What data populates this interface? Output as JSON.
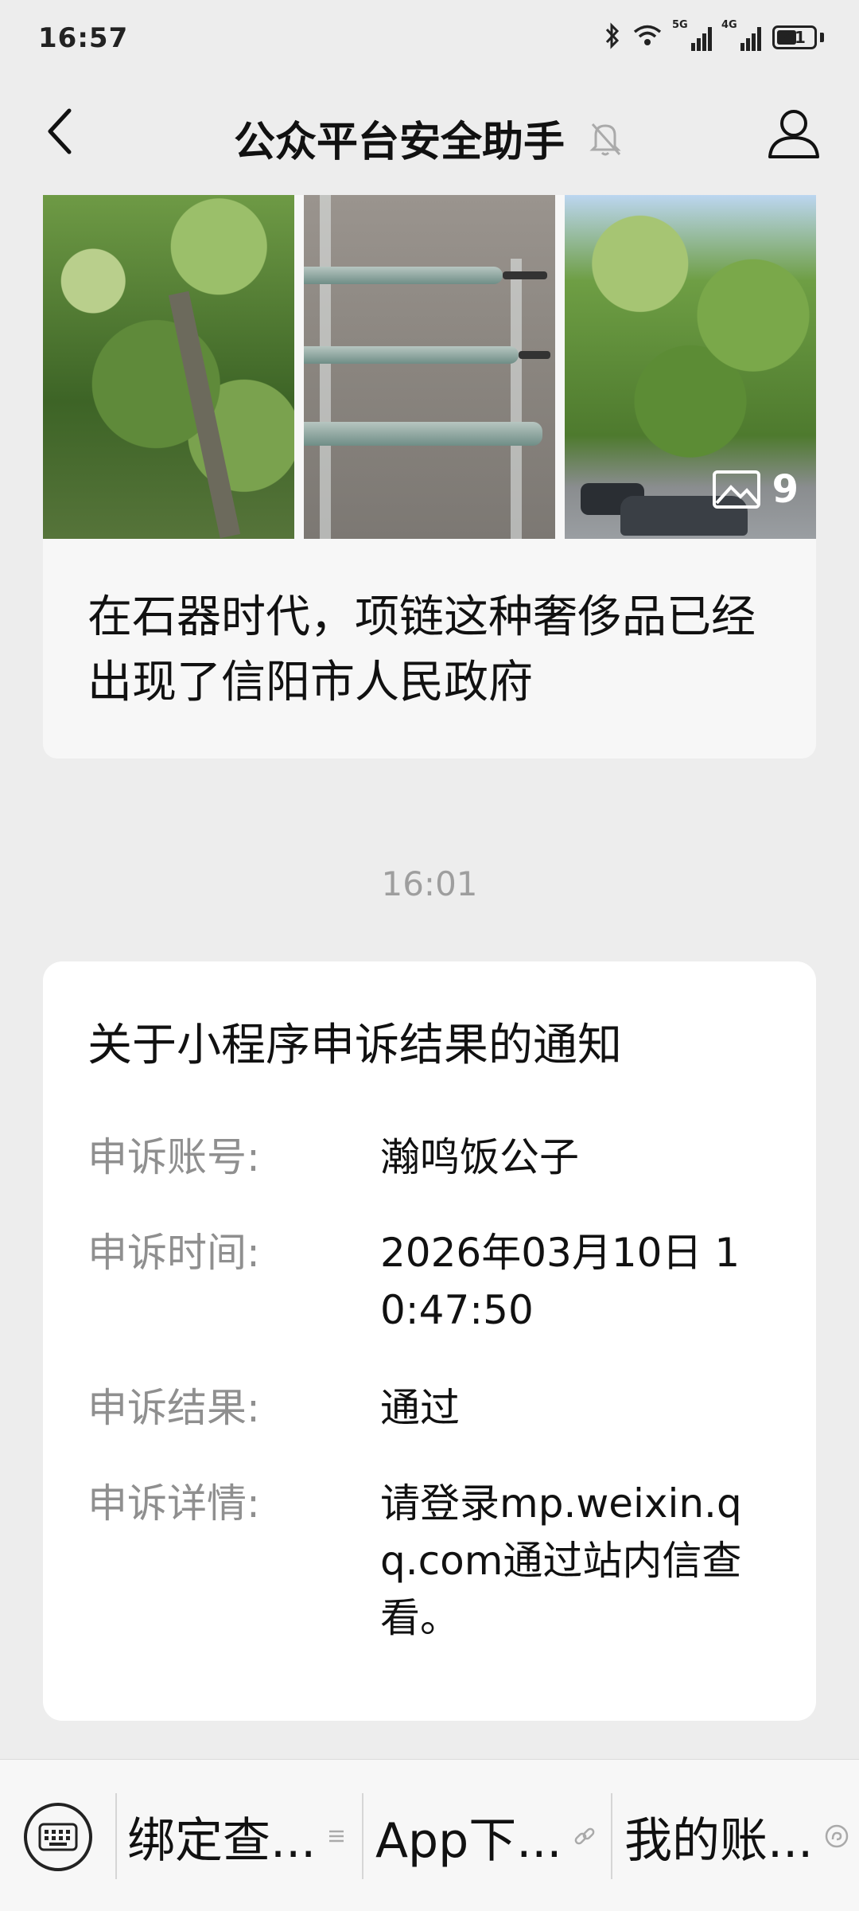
{
  "status_bar": {
    "time": "16:57",
    "network_1": "5G",
    "network_2": "4G",
    "battery": "41"
  },
  "header": {
    "title": "公众平台安全助手"
  },
  "article": {
    "title": "在石器时代，项链这种奢侈品已经出现了信阳市人民政府",
    "photo_count": "9"
  },
  "message_time": "16:01",
  "notice": {
    "title": "关于小程序申诉结果的通知",
    "fields": [
      {
        "label": "申诉账号:",
        "value": "瀚鸣饭公子"
      },
      {
        "label": "申诉时间:",
        "value": "2026年03月10日 10:47:50"
      },
      {
        "label": "申诉结果:",
        "value": "通过"
      },
      {
        "label": "申诉详情:",
        "value": "请登录mp.weixin.qq.com通过站内信查看。"
      }
    ]
  },
  "bottom_menu": {
    "items": [
      {
        "label": "绑定查...",
        "icon": "menu-list-icon"
      },
      {
        "label": "App下...",
        "icon": "link-icon"
      },
      {
        "label": "我的账...",
        "icon": "mini-program-icon"
      }
    ]
  },
  "icons": {
    "back": "chevron-left-icon",
    "mute": "bell-off-icon",
    "profile": "person-icon",
    "keyboard": "keyboard-icon",
    "gallery": "image-icon"
  }
}
